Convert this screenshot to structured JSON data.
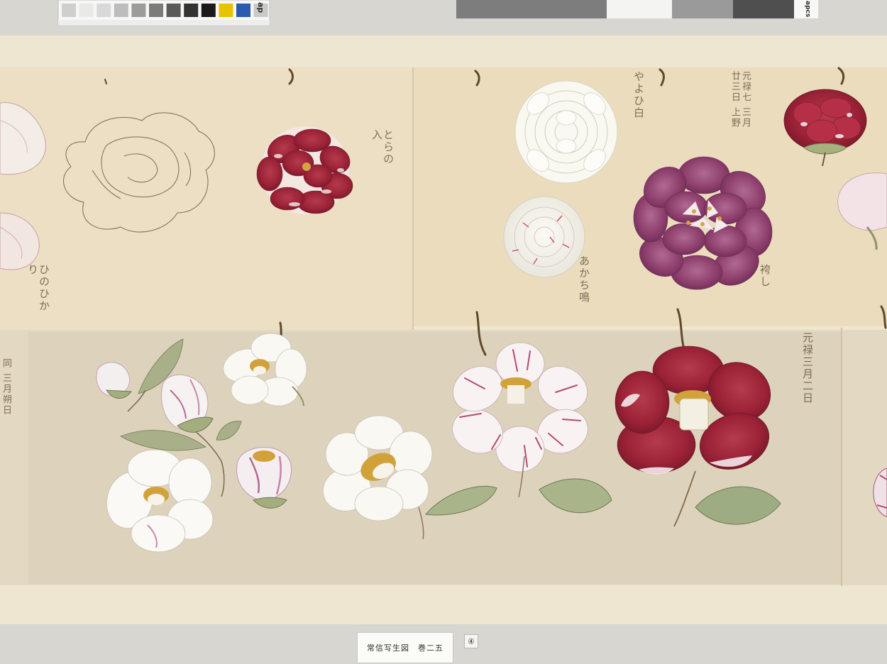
{
  "label": {
    "text": "常信写生図　巻二五"
  },
  "plate_number": "④",
  "color_strip": {
    "logo_left": "ap",
    "logo_right": "apcs",
    "swatches": [
      "#cfcfcf",
      "#e9e9e9",
      "#d9d9d9",
      "#bdbdbd",
      "#9c9c9c",
      "#7b7b7b",
      "#5a5a5a",
      "#333333",
      "#1a1a1a",
      "#e8c400",
      "#2a5bb0",
      "#c9c9c9"
    ],
    "gray_bars": [
      "#7d7d7d",
      "#f4f4f2",
      "#9a9a9a",
      "#4f4f4f",
      "#bfbfbf"
    ]
  },
  "inscriptions": {
    "top_left": "ひのひかり",
    "top_mid": "とらの入",
    "top_right_1": "やよひ白",
    "top_right_2": "元禄七 三月廿三日 上野",
    "mid_1": "あかち鳴",
    "mid_2": "袴し",
    "bottom_right": "元禄三月二日",
    "bottom_left": "同 三月朔日"
  },
  "colors": {
    "background": "#d8d6d1",
    "paper_upper": "#ecdfc3",
    "paper_lower": "#e1d6bf",
    "camellia_red": "#a8283f",
    "camellia_purple": "#8c3f6b",
    "leaf_green": "#9aa57a"
  }
}
